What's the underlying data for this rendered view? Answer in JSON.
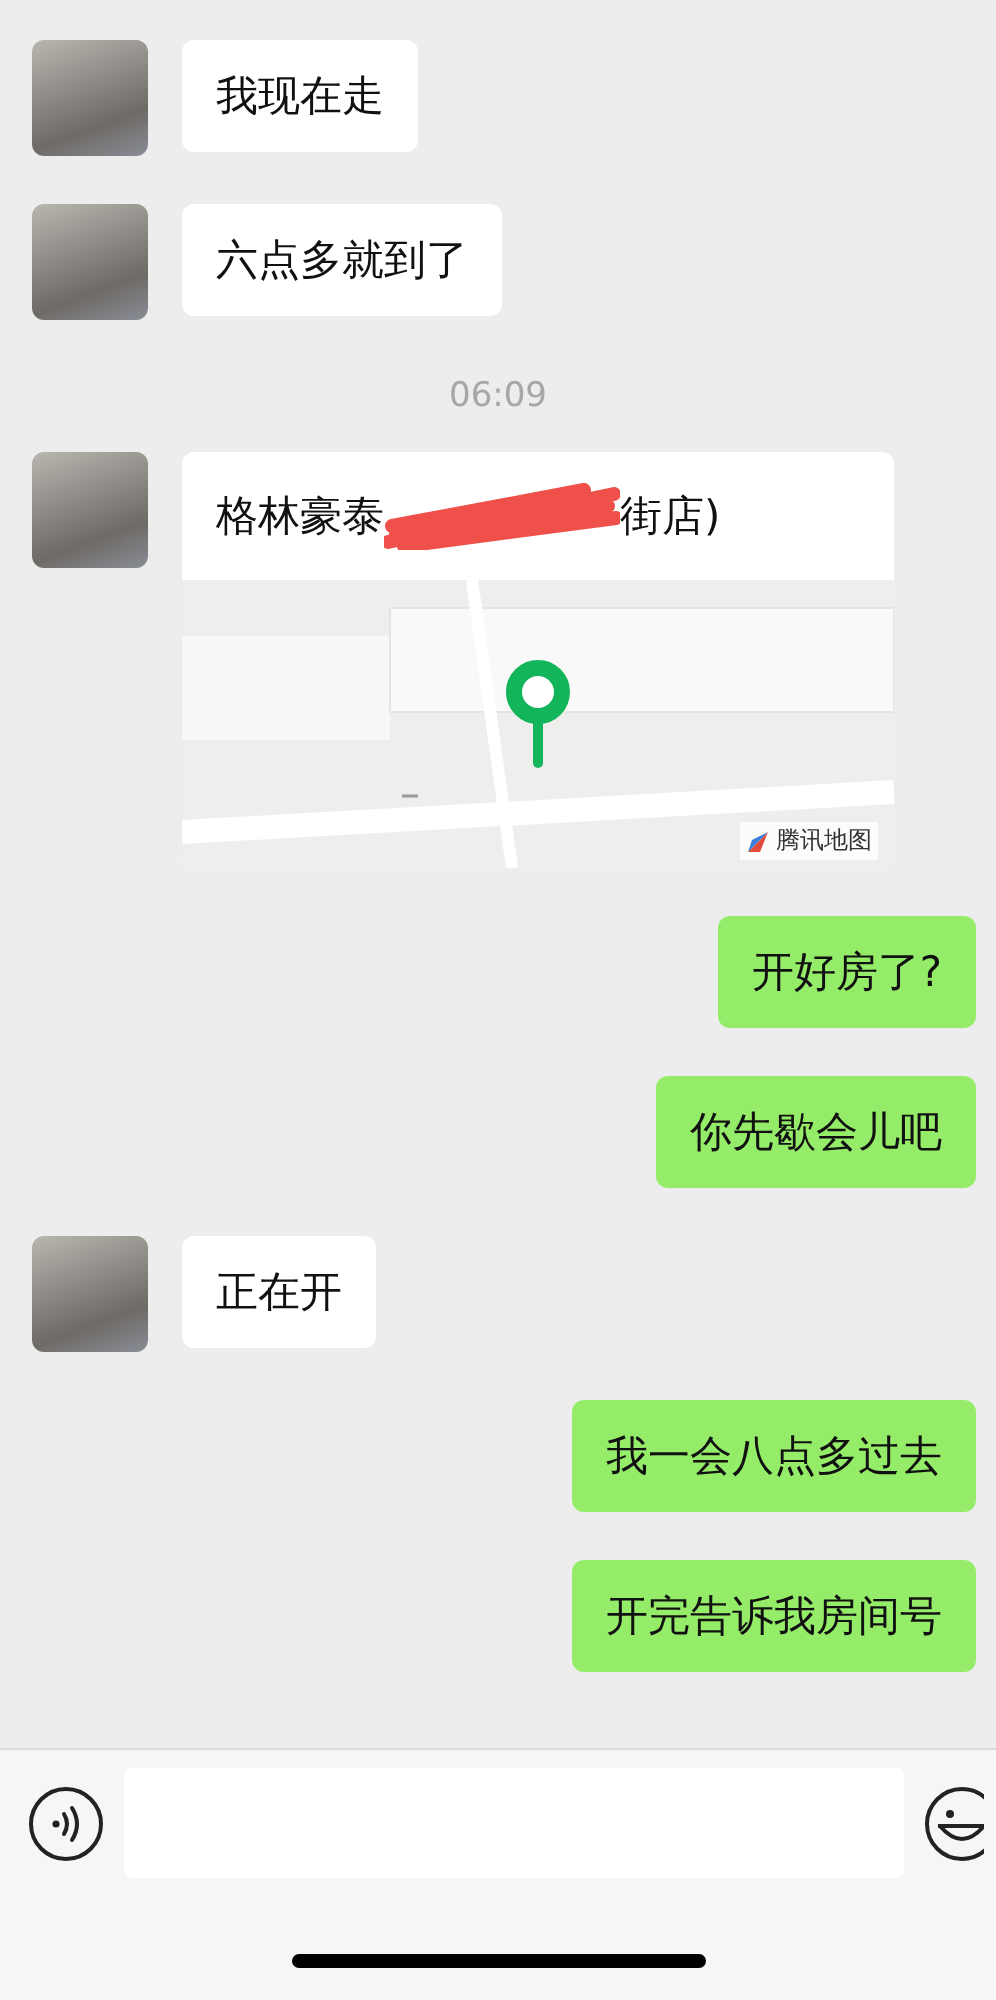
{
  "messages": [
    {
      "kind": "text",
      "outgoing": false,
      "text": "我现在走"
    },
    {
      "kind": "text",
      "outgoing": false,
      "text": "六点多就到了"
    },
    {
      "kind": "time",
      "text": "06:09"
    },
    {
      "kind": "location",
      "title_start": "格林豪泰",
      "title_end": "街店)",
      "map_label": "腾讯地图"
    },
    {
      "kind": "text",
      "outgoing": true,
      "text": "开好房了?"
    },
    {
      "kind": "text",
      "outgoing": true,
      "text": "你先歇会儿吧"
    },
    {
      "kind": "text",
      "outgoing": false,
      "text": "正在开"
    },
    {
      "kind": "text",
      "outgoing": true,
      "text": "我一会八点多过去"
    },
    {
      "kind": "text",
      "outgoing": true,
      "text": "开完告诉我房间号"
    }
  ]
}
